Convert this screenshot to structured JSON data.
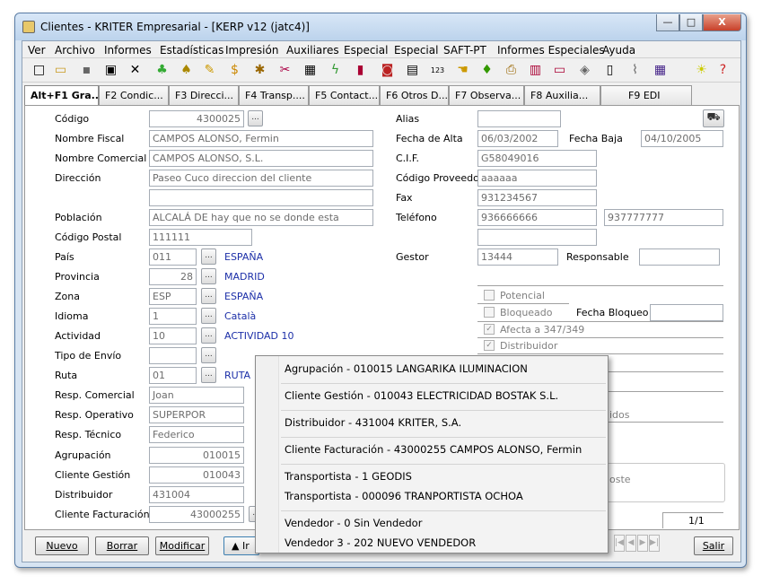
{
  "window": {
    "title": "Clientes - KRITER Empresarial - [KERP v12 (jatc4)]",
    "buttons": {
      "minimize": "—",
      "maximize": "□",
      "close": "X"
    }
  },
  "menu": [
    "Ver",
    "Archivo",
    "Informes",
    "Estadísticas",
    "Impresión",
    "Auxiliares",
    "Especial",
    "Especial",
    "SAFT-PT",
    "Informes Especiales",
    "Ayuda"
  ],
  "toolbar_icons": [
    "new-icon",
    "open-icon",
    "save-icon",
    "edit-icon",
    "delete-icon",
    "tree-icon",
    "filter-icon",
    "pencil-icon",
    "money-icon",
    "bug-icon",
    "tools-icon",
    "grid-icon",
    "lightning-icon",
    "chart-icon",
    "camera-icon",
    "table-icon",
    "counter-icon",
    "hand-icon",
    "group-icon",
    "printer-icon",
    "document-icon",
    "window-icon",
    "tag-icon",
    "file-icon",
    "clip-icon",
    "calendar-icon",
    "bulb-icon",
    "help-icon"
  ],
  "tabs": [
    "Alt+F1 Gra...",
    "F2 Condic...",
    "F3 Direcci...",
    "F4 Transp....",
    "F5 Contact...",
    "F6 Otros D...",
    "F7 Observa...",
    "F8 Auxilia...",
    "F9 EDI"
  ],
  "form": {
    "codigo": {
      "label": "Código",
      "value": "4300025"
    },
    "nombre_fiscal": {
      "label": "Nombre Fiscal",
      "value": "CAMPOS ALONSO, Fermin"
    },
    "nombre_comercial": {
      "label": "Nombre Comercial",
      "value": "CAMPOS ALONSO, S.L."
    },
    "direccion": {
      "label": "Dirección",
      "value": "Paseo Cuco direccion del cliente",
      "value2": ""
    },
    "poblacion": {
      "label": "Población",
      "value": "ALCALÁ DE hay que no se donde esta"
    },
    "codigo_postal": {
      "label": "Código Postal",
      "value": "111111"
    },
    "pais": {
      "label": "País",
      "value": "011",
      "desc": "ESPAÑA"
    },
    "provincia": {
      "label": "Provincia",
      "value": "28",
      "desc": "MADRID"
    },
    "zona": {
      "label": "Zona",
      "value": "ESP",
      "desc": "ESPAÑA"
    },
    "idioma": {
      "label": "Idioma",
      "value": "1",
      "desc": "Català"
    },
    "actividad": {
      "label": "Actividad",
      "value": "10",
      "desc": "ACTIVIDAD 10"
    },
    "tipo_envio": {
      "label": "Tipo de Envío",
      "value": ""
    },
    "ruta": {
      "label": "Ruta",
      "value": "01",
      "desc": "RUTA"
    },
    "resp_comercial": {
      "label": "Resp. Comercial",
      "value": "Joan"
    },
    "resp_operativo": {
      "label": "Resp. Operativo",
      "value": "SUPERPOR"
    },
    "resp_tecnico": {
      "label": "Resp. Técnico",
      "value": "Federico"
    },
    "agrupacion": {
      "label": "Agrupación",
      "value": "010015"
    },
    "cliente_gestion": {
      "label": "Cliente Gestión",
      "value": "010043"
    },
    "distribuidor": {
      "label": "Distribuidor",
      "value": "431004"
    },
    "cliente_facturacion": {
      "label": "Cliente Facturación",
      "value": "43000255"
    },
    "alias": {
      "label": "Alias",
      "value": ""
    },
    "fecha_alta": {
      "label": "Fecha de Alta",
      "value": "06/03/2002"
    },
    "fecha_baja": {
      "label": "Fecha Baja",
      "value": "04/10/2005"
    },
    "cif": {
      "label": "C.I.F.",
      "value": "G58049016"
    },
    "codigo_proveedor": {
      "label": "Código Proveedor",
      "value": "aaaaaa"
    },
    "fax": {
      "label": "Fax",
      "value": "931234567"
    },
    "telefono": {
      "label": "Teléfono",
      "value": "936666666",
      "value2": "937777777"
    },
    "extra_field": {
      "value": ""
    },
    "gestor": {
      "label": "Gestor",
      "value": "13444"
    },
    "responsable": {
      "label": "Responsable",
      "value": ""
    },
    "potencial": {
      "label": "Potencial",
      "checked": false
    },
    "bloqueado": {
      "label": "Bloqueado",
      "checked": false
    },
    "fecha_bloqueo": {
      "label": "Fecha Bloqueo",
      "value": ""
    },
    "afecta_347": {
      "label": "Afecta a 347/349",
      "checked": true
    },
    "distribuidor_chk": {
      "label": "Distribuidor",
      "checked": true
    },
    "partial_1": "idos",
    "partial_2": "oste",
    "record_count": "1/1"
  },
  "popup": {
    "items": [
      "Agrupación - 010015 LANGARIKA ILUMINACION",
      "Cliente Gestión - 010043 ELECTRICIDAD BOSTAK S.L.",
      "Distribuidor - 431004 KRITER, S.A.",
      "Cliente Facturación - 43000255 CAMPOS ALONSO, Fermin",
      "Transportista - 1 GEODIS",
      "Transportista - 000096 TRANPORTISTA OCHOA",
      "Vendedor - 0 Sin Vendedor",
      "Vendedor 3 - 202 NUEVO VENDEDOR"
    ]
  },
  "buttons": {
    "nuevo": "Nuevo",
    "borrar": "Borrar",
    "modificar": "Modificar",
    "info_partial": "▲ Ir",
    "salir": "Salir"
  },
  "nav": [
    "|◀",
    "◀",
    "▶",
    "▶|"
  ]
}
